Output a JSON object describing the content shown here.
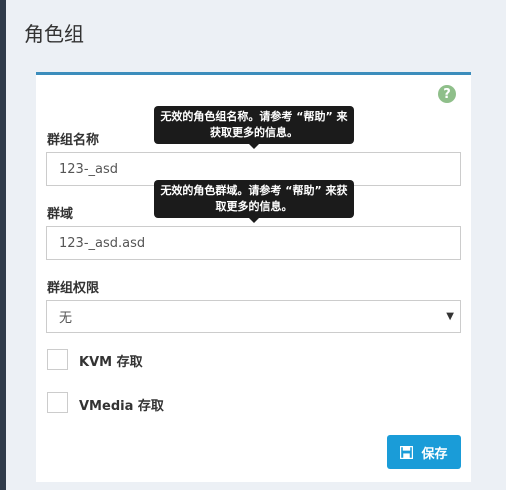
{
  "page": {
    "title": "角色组"
  },
  "help": {
    "icon": "question-circle-icon",
    "glyph": "?"
  },
  "form": {
    "group_name": {
      "label": "群组名称",
      "value": "123-_asd",
      "tooltip": "无效的角色组名称。请参考 “帮助” 来获取更多的信息。"
    },
    "domain": {
      "label": "群域",
      "value": "123-_asd.asd",
      "tooltip": "无效的角色群域。请参考 “帮助” 来获取更多的信息。"
    },
    "privilege": {
      "label": "群组权限",
      "selected": "无"
    },
    "kvm": {
      "label": "KVM 存取",
      "checked": false
    },
    "vmedia": {
      "label": "VMedia 存取",
      "checked": false
    },
    "save_label": "保存"
  },
  "colors": {
    "accent": "#3c8dbc",
    "button": "#1a9cd8",
    "help": "#8fbf8a",
    "tooltip": "#1b1b1b"
  }
}
